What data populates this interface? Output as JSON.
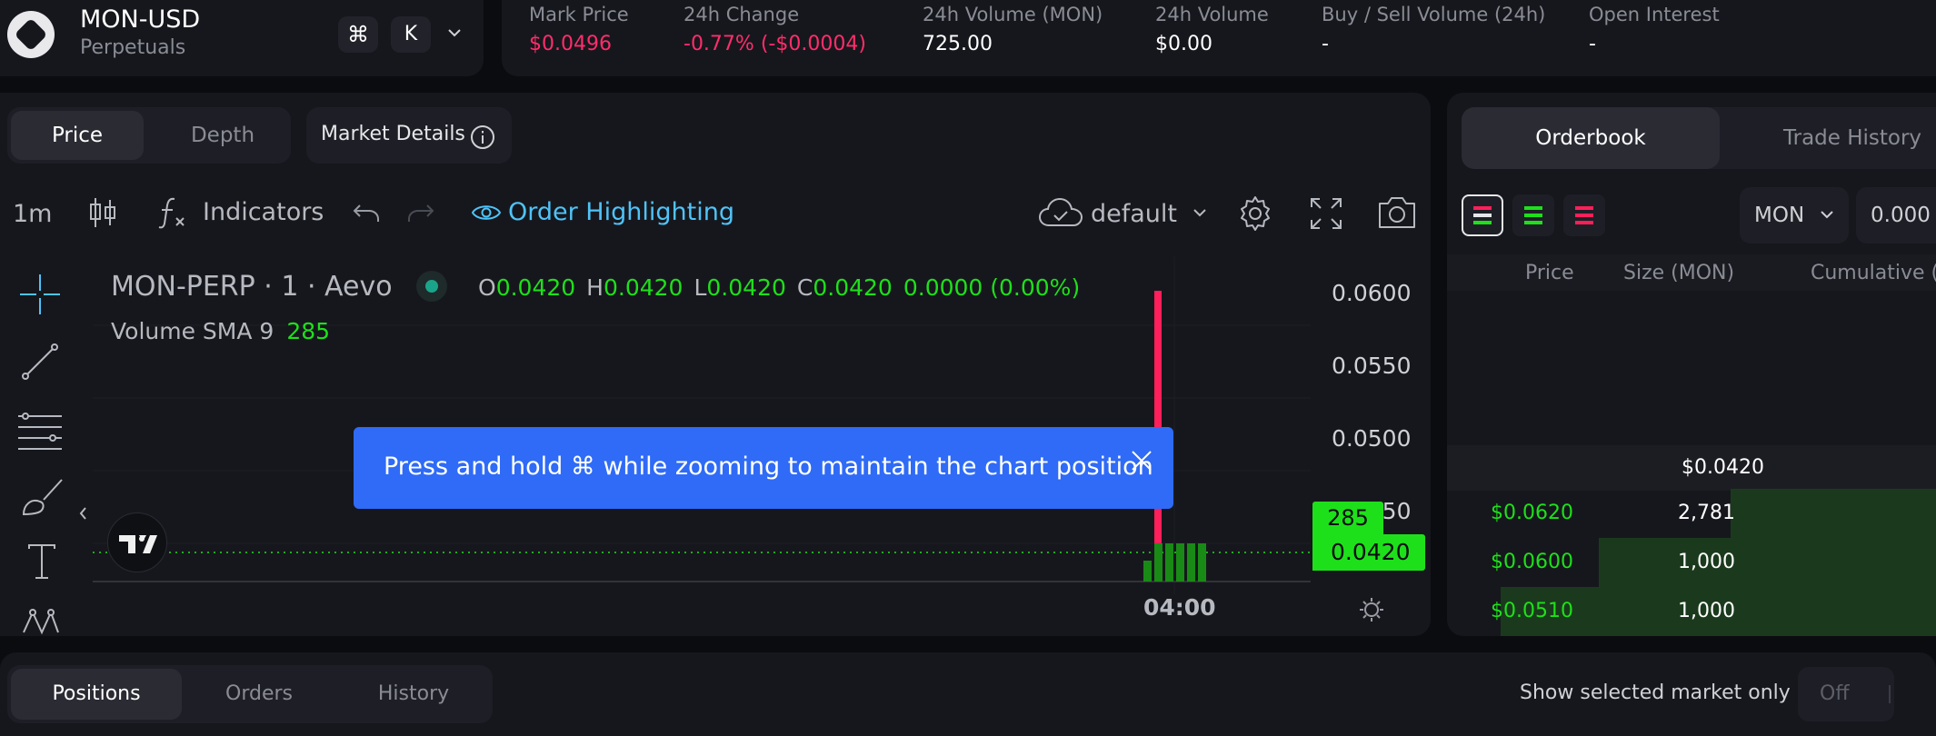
{
  "market": {
    "symbol": "MON-USD",
    "type": "Perpetuals",
    "cmd_key": "⌘",
    "k_key": "K"
  },
  "stats": [
    {
      "label": "Mark Price",
      "value": "$0.0496",
      "color": "#ff2d6a"
    },
    {
      "label": "24h Change",
      "value": "-0.77% (-$0.0004)",
      "color": "#ff2d6a"
    },
    {
      "label": "24h Volume (MON)",
      "value": "725.00",
      "color": "#ffffff"
    },
    {
      "label": "24h Volume",
      "value": "$0.00",
      "color": "#ffffff"
    },
    {
      "label": "Buy / Sell Volume (24h)",
      "value": "-",
      "color": "#ffffff"
    },
    {
      "label": "Open Interest",
      "value": "-",
      "color": "#ffffff"
    }
  ],
  "chart_tabs": {
    "price": "Price",
    "depth": "Depth",
    "market_details": "Market Details"
  },
  "toolbar": {
    "interval": "1m",
    "indicators": "Indicators",
    "order_highlighting": "Order Highlighting",
    "layout": "default"
  },
  "legend": {
    "title": "MON-PERP · 1 · Aevo",
    "o_label": "O",
    "o": "0.0420",
    "h_label": "H",
    "h": "0.0420",
    "l_label": "L",
    "l": "0.0420",
    "c_label": "C",
    "c": "0.0420",
    "change": "0.0000 (0.00%)",
    "sma_label": "Volume SMA 9",
    "sma_value": "285"
  },
  "chart_data": {
    "type": "bar",
    "price_axis": [
      "0.0600",
      "0.0550",
      "0.0500",
      "0.0450"
    ],
    "time_label": "04:00",
    "last_price": "0.0420",
    "volume_badge": "285",
    "volume_bars": [
      0.42,
      0.78,
      0.78,
      0.78,
      0.78,
      0.78
    ],
    "price_spike_top": "0.0600"
  },
  "toast": {
    "message": "Press and hold ⌘ while zooming to maintain the chart position"
  },
  "orderbook": {
    "tab_orderbook": "Orderbook",
    "tab_trades": "Trade History",
    "unit": "MON",
    "precision": "0.000",
    "col_price": "Price",
    "col_size": "Size (MON)",
    "col_cumulative": "Cumulative (MON)",
    "mid_price": "$0.0420",
    "bids": [
      {
        "price": "$0.0620",
        "size": "2,781",
        "depth": 0.42
      },
      {
        "price": "$0.0600",
        "size": "1,000",
        "depth": 0.69
      },
      {
        "price": "$0.0510",
        "size": "1,000",
        "depth": 0.89
      }
    ]
  },
  "bottom": {
    "tabs": [
      "Positions",
      "Orders",
      "History"
    ],
    "filter_label": "Show selected market only",
    "toggle": "Off"
  },
  "colors": {
    "green": "#1ee01a",
    "red": "#ff1f5a",
    "accent": "#4fc3f7",
    "toast": "#2f6bf6"
  }
}
